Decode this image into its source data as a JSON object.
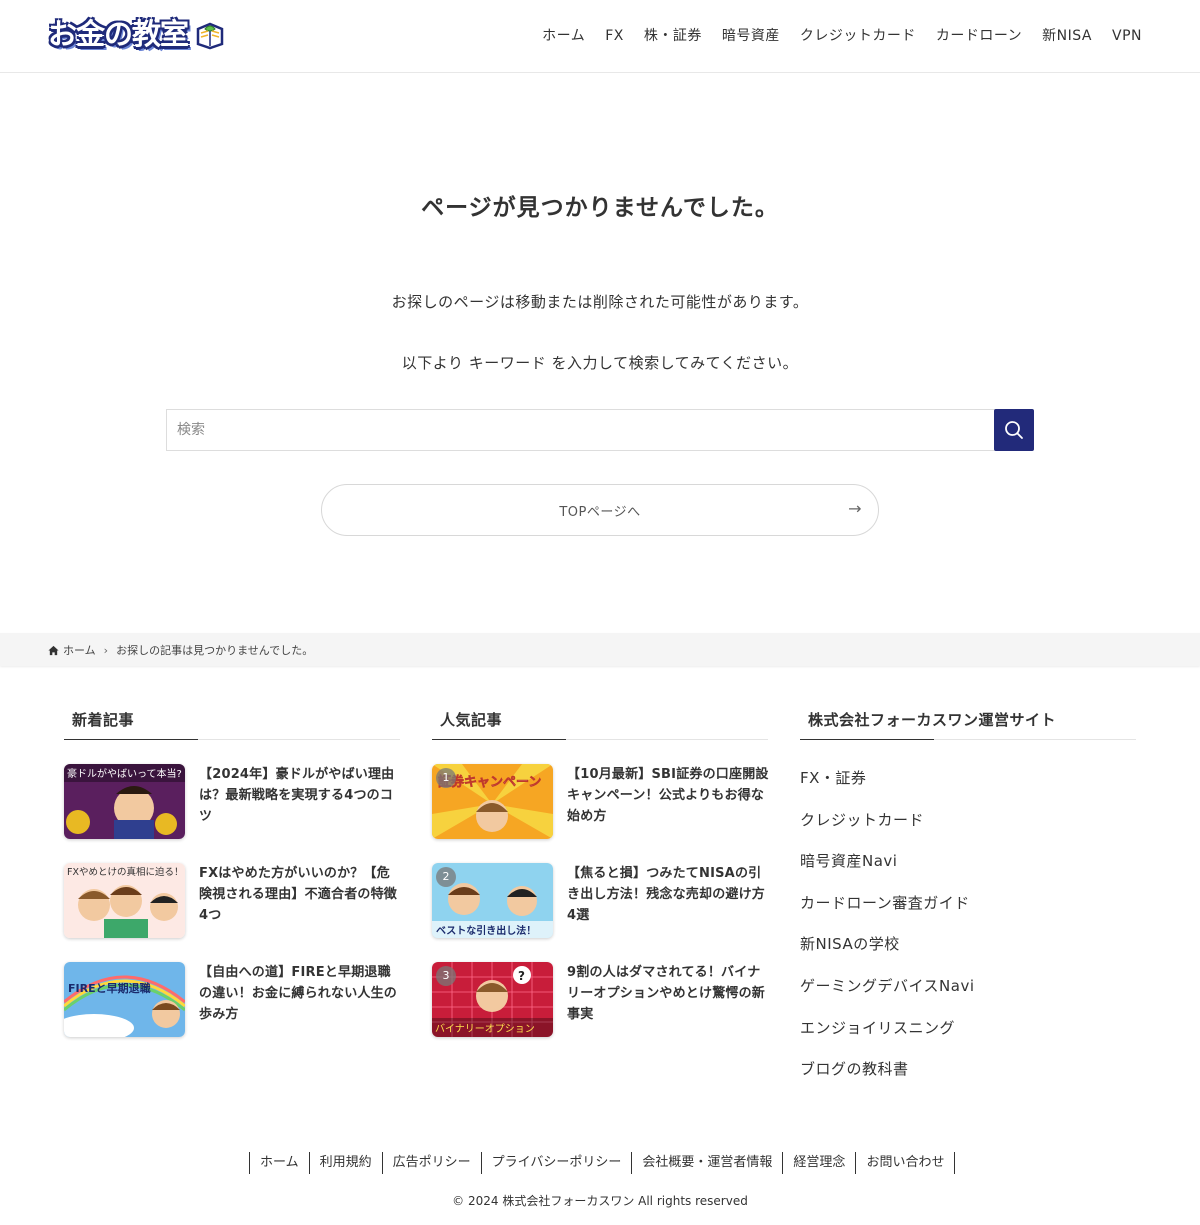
{
  "header": {
    "logo_text": "お金の教室",
    "nav": [
      "ホーム",
      "FX",
      "株・証券",
      "暗号資産",
      "クレジットカード",
      "カードローン",
      "新NISA",
      "VPN"
    ]
  },
  "main": {
    "title": "ページが見つかりませんでした。",
    "message1": "お探しのページは移動または削除された可能性があります。",
    "message2": "以下より キーワード を入力して検索してみてください。",
    "search_placeholder": "検索",
    "top_button_label": "TOPページへ",
    "top_button_arrow": "→"
  },
  "breadcrumb": {
    "home": "ホーム",
    "current": "お探しの記事は見つかりませんでした。"
  },
  "widgets": {
    "new_posts": {
      "title": "新着記事",
      "items": [
        {
          "title": "【2024年】豪ドルがやばい理由は？最新戦略を実現する4つのコツ",
          "thumb_text": "豪ドルがやばいって本当?"
        },
        {
          "title": "FXはやめた方がいいのか？【危険視される理由】不適合者の特徴4つ",
          "thumb_text": "FXやめとけの真相に迫る！"
        },
        {
          "title": "【自由への道】FIREと早期退職の違い！お金に縛られない人生の歩み方",
          "thumb_text": "FIREと早期退職"
        }
      ]
    },
    "popular_posts": {
      "title": "人気記事",
      "items": [
        {
          "rank": "1",
          "title": "【10月最新】SBI証券の口座開設キャンペーン！公式よりもお得な始め方",
          "thumb_text": "証券キャンペーン"
        },
        {
          "rank": "2",
          "title": "【焦ると損】つみたてNISAの引き出し方法！残念な売却の避け方4選",
          "thumb_text": "ベストな引き出し法！"
        },
        {
          "rank": "3",
          "title": "9割の人はダマされてる！バイナリーオプションやめとけ驚愕の新事実",
          "thumb_text": "バイナリーオプション"
        }
      ]
    },
    "sites": {
      "title": "株式会社フォーカスワン運営サイト",
      "links": [
        "FX・証券",
        "クレジットカード",
        "暗号資産Navi",
        "カードローン審査ガイド",
        "新NISAの学校",
        "ゲーミングデバイスNavi",
        "エンジョイリスニング",
        "ブログの教科書"
      ]
    }
  },
  "footer": {
    "nav": [
      "ホーム",
      "利用規約",
      "広告ポリシー",
      "プライバシーポリシー",
      "会社概要・運営者情報",
      "経営理念",
      "お問い合わせ"
    ],
    "copyright": "© 2024 株式会社フォーカスワン All rights reserved"
  },
  "colors": {
    "accent": "#222a7a",
    "text": "#333333",
    "breadcrumb_bg": "#f5f5f5"
  },
  "icons": [
    "search-icon",
    "home-icon",
    "chevron-right-icon",
    "arrow-right-icon",
    "book-icon"
  ]
}
